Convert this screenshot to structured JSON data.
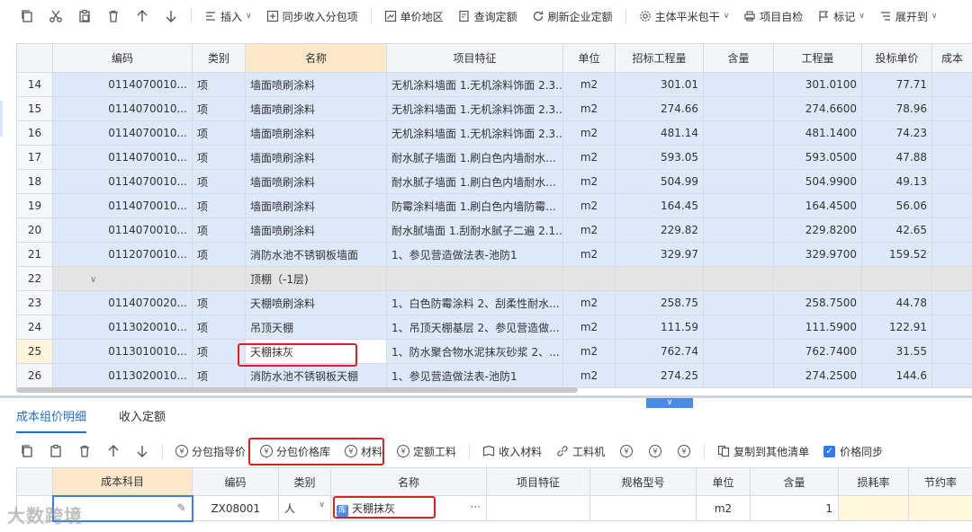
{
  "toolbar": {
    "insert": "插入",
    "sync": "同步收入分包项",
    "price_region": "单价地区",
    "query_quota": "查询定额",
    "refresh_quota": "刷新企业定额",
    "main_body": "主体平米包干",
    "self_check": "项目自检",
    "mark": "标记",
    "expand": "展开到"
  },
  "grid": {
    "headers": [
      "编码",
      "类别",
      "名称",
      "项目特征",
      "单位",
      "招标工程量",
      "含量",
      "工程量",
      "投标单价",
      "成本"
    ],
    "rows": [
      {
        "num": "14",
        "code": "0114070010...",
        "type": "项",
        "name": "墙面喷刷涂料",
        "feature": "无机涂料墙面 1.无机涂料饰面 2.3...",
        "unit": "m2",
        "bid_qty": "301.01",
        "content": "",
        "qty": "301.0100",
        "price": "77.71"
      },
      {
        "num": "15",
        "code": "0114070010...",
        "type": "项",
        "name": "墙面喷刷涂料",
        "feature": "无机涂料墙面 1.无机涂料饰面 2.3...",
        "unit": "m2",
        "bid_qty": "274.66",
        "content": "",
        "qty": "274.6600",
        "price": "78.96"
      },
      {
        "num": "16",
        "code": "0114070010...",
        "type": "项",
        "name": "墙面喷刷涂料",
        "feature": "无机涂料墙面 1.无机涂料饰面 2.3...",
        "unit": "m2",
        "bid_qty": "481.14",
        "content": "",
        "qty": "481.1400",
        "price": "74.23"
      },
      {
        "num": "17",
        "code": "0114070010...",
        "type": "项",
        "name": "墙面喷刷涂料",
        "feature": "耐水腻子墙面 1.刷白色内墙耐水...",
        "unit": "m2",
        "bid_qty": "593.05",
        "content": "",
        "qty": "593.0500",
        "price": "47.88"
      },
      {
        "num": "18",
        "code": "0114070010...",
        "type": "项",
        "name": "墙面喷刷涂料",
        "feature": "耐水腻子墙面 1.刷白色内墙耐水...",
        "unit": "m2",
        "bid_qty": "504.99",
        "content": "",
        "qty": "504.9900",
        "price": "49.13"
      },
      {
        "num": "19",
        "code": "0114070010...",
        "type": "项",
        "name": "墙面喷刷涂料",
        "feature": "防霉涂料墙面 1.刷白色内墙防霉...",
        "unit": "m2",
        "bid_qty": "164.45",
        "content": "",
        "qty": "164.4500",
        "price": "56.06"
      },
      {
        "num": "20",
        "code": "0114070010...",
        "type": "项",
        "name": "墙面喷刷涂料",
        "feature": "耐水腻墙面 1.刮耐水腻子二遍 2.1...",
        "unit": "m2",
        "bid_qty": "229.82",
        "content": "",
        "qty": "229.8200",
        "price": "42.65"
      },
      {
        "num": "21",
        "code": "0112070010...",
        "type": "项",
        "name": "消防水池不锈钢板墙面",
        "feature": "1、参见营造做法表-池防1",
        "unit": "m2",
        "bid_qty": "329.97",
        "content": "",
        "qty": "329.9700",
        "price": "159.52"
      },
      {
        "num": "22",
        "group": true,
        "name": "顶棚（-1层)"
      },
      {
        "num": "23",
        "code": "0114070020...",
        "type": "项",
        "name": "天棚喷刷涂料",
        "feature": "1、白色防霉涂料 2、刮柔性耐水...",
        "unit": "m2",
        "bid_qty": "258.75",
        "content": "",
        "qty": "258.7500",
        "price": "44.78"
      },
      {
        "num": "24",
        "code": "0113020010...",
        "type": "项",
        "name": "吊顶天棚",
        "feature": "1、吊顶天棚基层 2、参见营造做...",
        "unit": "m2",
        "bid_qty": "111.59",
        "content": "",
        "qty": "111.5900",
        "price": "122.91"
      },
      {
        "num": "25",
        "selected": true,
        "code": "0113010010...",
        "type": "项",
        "name": "天棚抹灰",
        "feature": "1、防水聚合物水泥抹灰砂浆 2、...",
        "unit": "m2",
        "bid_qty": "762.74",
        "content": "",
        "qty": "762.7400",
        "price": "31.55"
      },
      {
        "num": "26",
        "code": "0113020010...",
        "type": "项",
        "name": "消防水池不锈钢板天棚",
        "feature": "1、参见营造做法表-池防1",
        "unit": "m2",
        "bid_qty": "274.25",
        "content": "",
        "qty": "274.2500",
        "price": "144.6"
      }
    ]
  },
  "tabs": [
    "成本组价明细",
    "收入定额"
  ],
  "toolbar2": {
    "sub_guide": "分包指导价",
    "sub_lib": "分包价格库",
    "material": "材料",
    "quota_labor": "定额工料",
    "income_material": "收入材料",
    "labor_machine": "工料机",
    "copy_to": "复制到其他清单",
    "price_sync": "价格同步"
  },
  "sub_grid": {
    "headers": [
      "成本科目",
      "编码",
      "类别",
      "名称",
      "项目特征",
      "规格型号",
      "单位",
      "含量",
      "损耗率",
      "节约率"
    ],
    "row": {
      "subject": "",
      "code": "ZX08001",
      "type": "人",
      "lib_tag": "库",
      "name": "天棚抹灰",
      "feature": "",
      "spec": "",
      "unit": "m2",
      "content": "1",
      "loss": "",
      "save": ""
    }
  },
  "watermark": "大数跨境",
  "icons": [
    "copy-icon",
    "cut-icon",
    "paste-icon",
    "delete-icon",
    "arrow-up-icon",
    "arrow-down-icon",
    "gear-icon",
    "flag-icon",
    "checkbox-icon"
  ]
}
